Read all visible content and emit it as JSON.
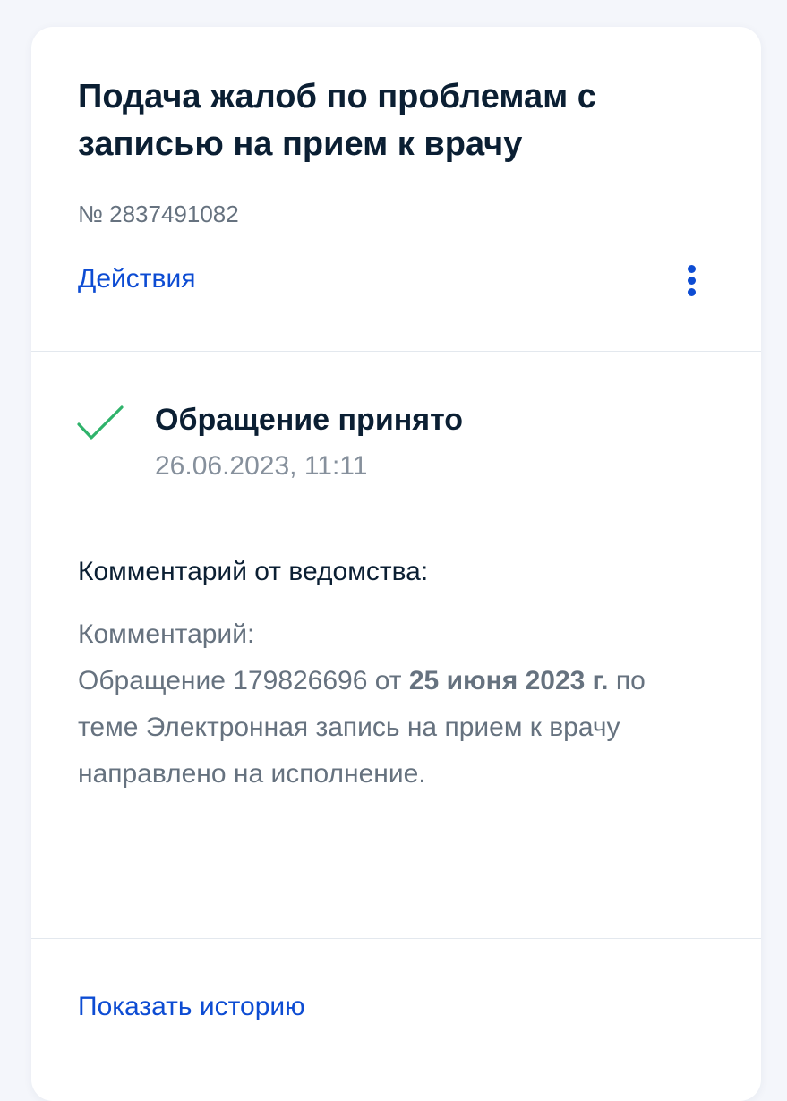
{
  "request": {
    "title": "Подача жалоб по проблемам с записью на прием к врачу",
    "number": "№ 2837491082",
    "actions_label": "Действия"
  },
  "status": {
    "title": "Обращение принято",
    "datetime": "26.06.2023, 11:11",
    "icon": "check-icon"
  },
  "comment": {
    "heading": "Комментарий от ведомства:",
    "label": "Комментарий:",
    "text_start": "Обращение 179826696 от ",
    "date_bold": "25 июня 2023 г.",
    "text_end": " по теме Электронная запись на прием к врачу направлено на исполнение."
  },
  "footer": {
    "history_label": "Показать историю"
  },
  "colors": {
    "accent": "#0d4cd3",
    "success": "#2fb36b",
    "text_primary": "#0b1f33",
    "text_secondary": "#66727f"
  }
}
